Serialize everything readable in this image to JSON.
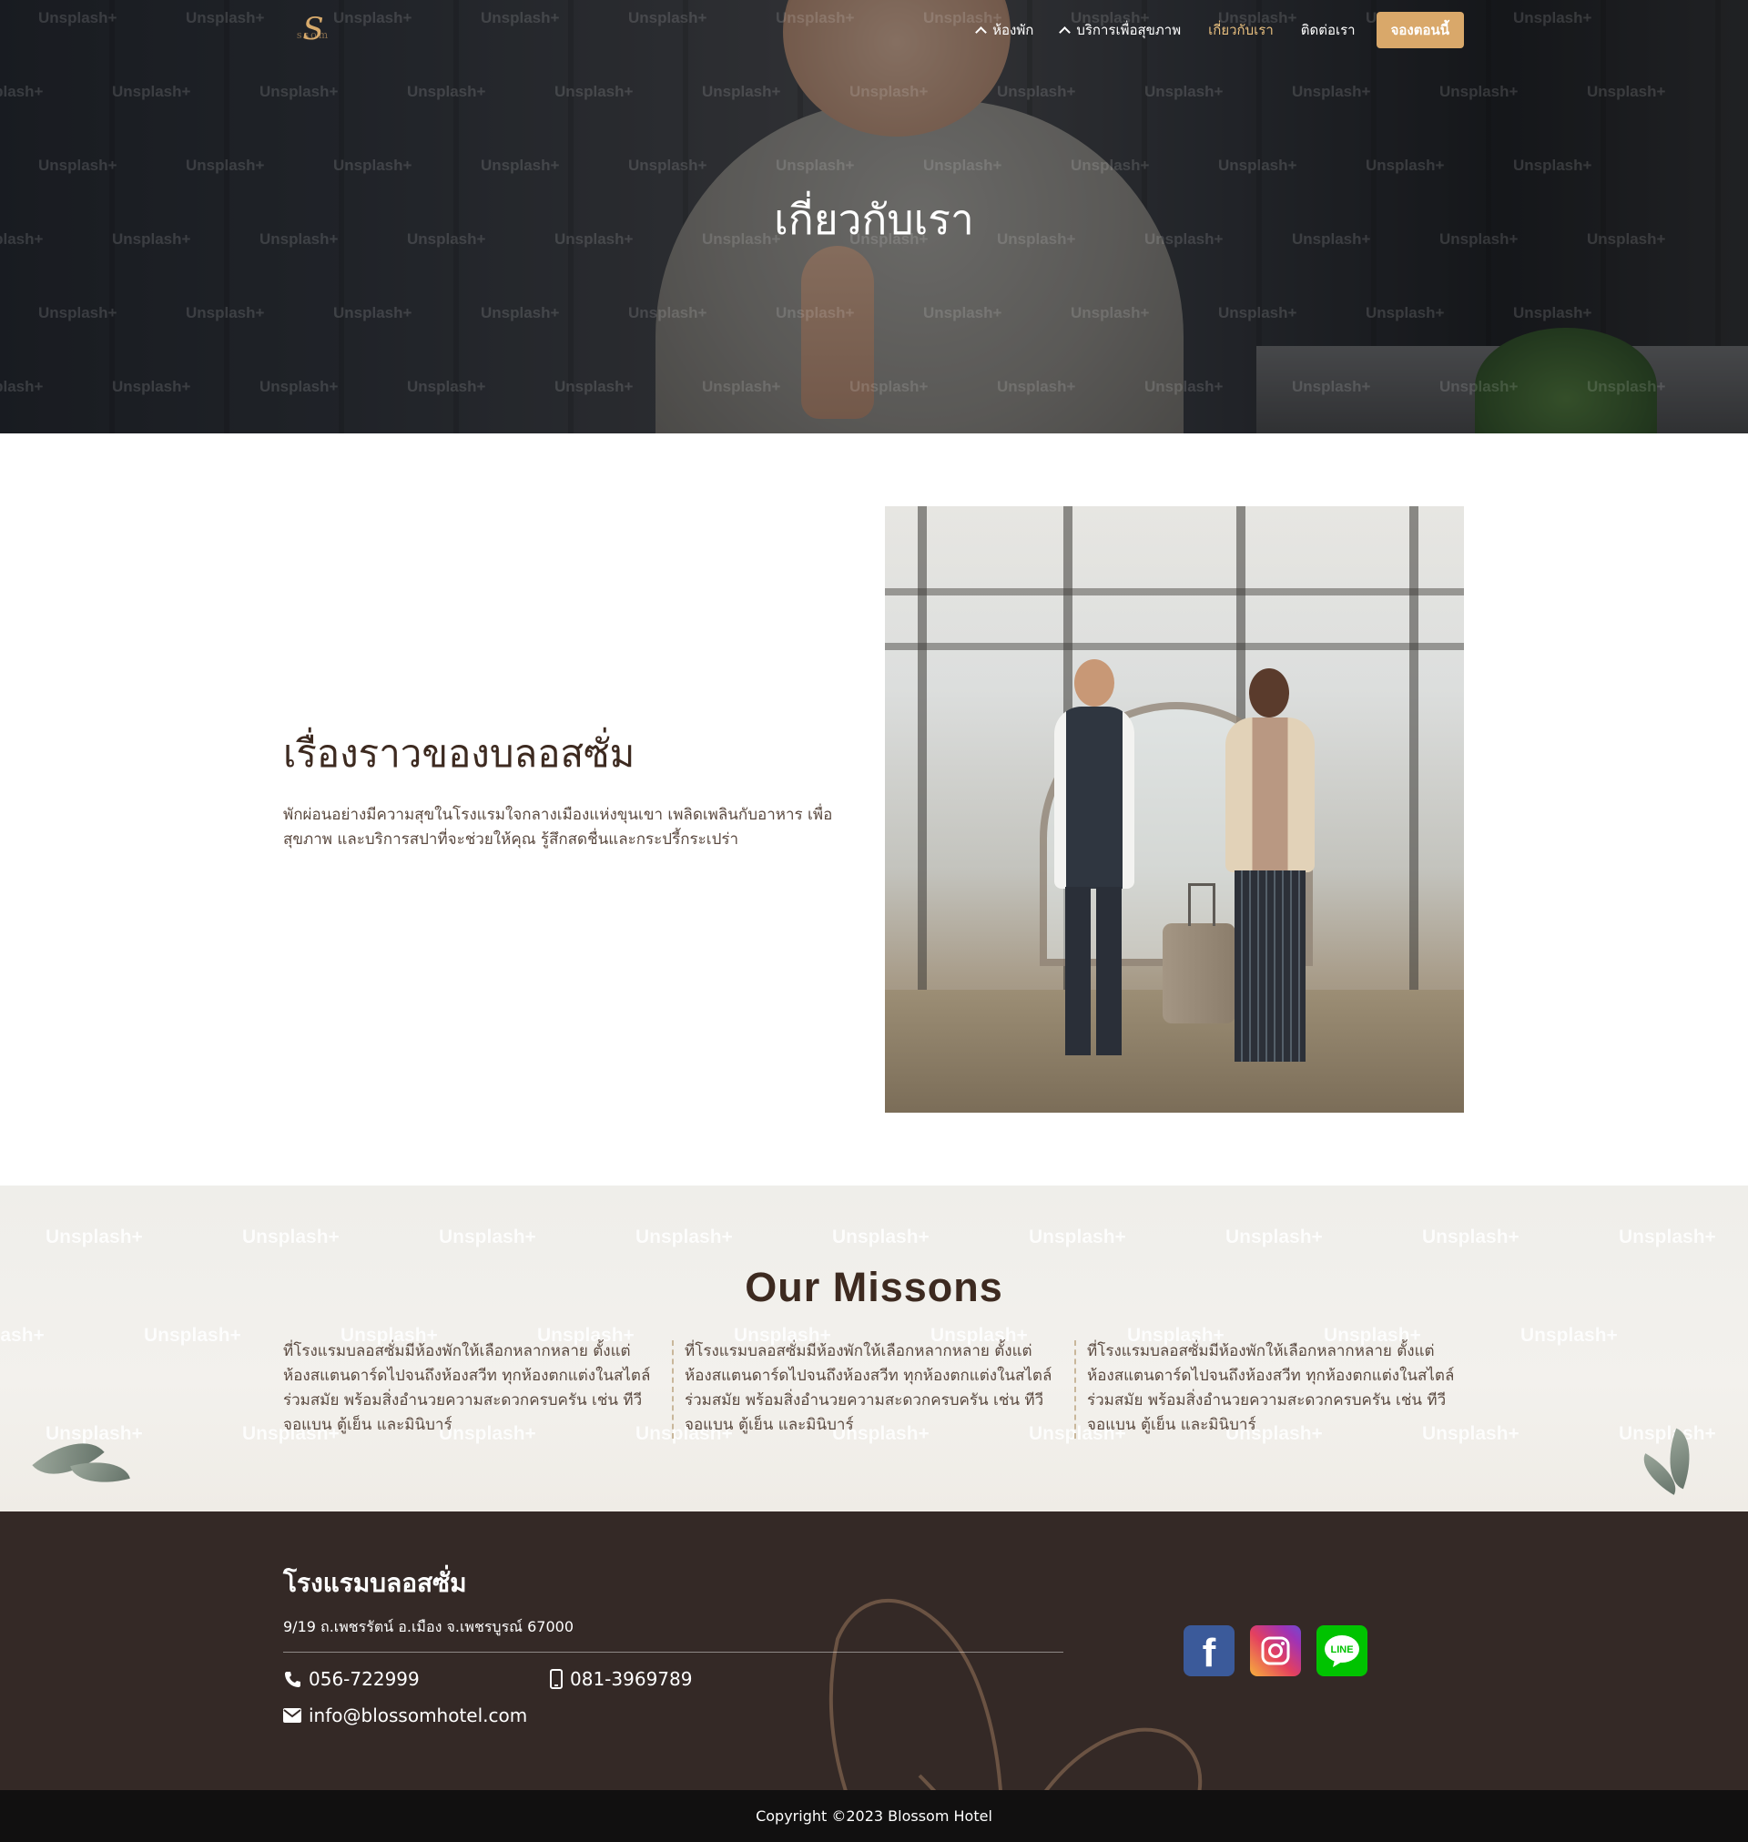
{
  "brand": {
    "logo_letter": "S",
    "logo_text": "ssom",
    "accent_color": "#d9a86a"
  },
  "nav": {
    "items": [
      {
        "label": "ห้องพัก",
        "has_caret": true
      },
      {
        "label": "บริการเพื่อสุขภาพ",
        "has_caret": true
      },
      {
        "label": "เกี่ยวกับเรา",
        "active": true
      },
      {
        "label": "ติดต่อเรา"
      }
    ],
    "book_label": "จองตอนนี้"
  },
  "hero": {
    "title": "เกี่ยวกับเรา",
    "watermark": "Unsplash+"
  },
  "story": {
    "heading": "เรื่องราวของบลอสซั่ม",
    "text": "พักผ่อนอย่างมีความสุขในโรงแรมใจกลางเมืองแห่งขุนเขา เพลิดเพลินกับอาหาร เพื่อสุขภาพ และบริการสปาที่จะช่วยให้คุณ รู้สึกสดชื่นและกระปรี้กระเปร่า"
  },
  "missions": {
    "title": "Our Missons",
    "watermark": "Unsplash+",
    "columns": [
      "ที่โรงแรมบลอสซั่มมีห้องพักให้เลือกหลากหลาย ตั้งแต่ห้องสแตนดาร์ดไปจนถึงห้องสวีท ทุกห้องตกแต่งในสไตล์ร่วมสมัย พร้อมสิ่งอำนวยความสะดวกครบครัน เช่น ทีวีจอแบน ตู้เย็น และมินิบาร์",
      "ที่โรงแรมบลอสซั่มมีห้องพักให้เลือกหลากหลาย ตั้งแต่ห้องสแตนดาร์ดไปจนถึงห้องสวีท ทุกห้องตกแต่งในสไตล์ร่วมสมัย พร้อมสิ่งอำนวยความสะดวกครบครัน เช่น ทีวีจอแบน ตู้เย็น และมินิบาร์",
      "ที่โรงแรมบลอสซั่มมีห้องพักให้เลือกหลากหลาย ตั้งแต่ห้องสแตนดาร์ดไปจนถึงห้องสวีท ทุกห้องตกแต่งในสไตล์ร่วมสมัย พร้อมสิ่งอำนวยความสะดวกครบครัน เช่น ทีวีจอแบน ตู้เย็น และมินิบาร์"
    ]
  },
  "footer": {
    "name": "โรงแรมบลอสซั่ม",
    "address": "9/19 ถ.เพชรรัตน์ อ.เมือง จ.เพชรบูรณ์ 67000",
    "phone": "056-722999",
    "mobile": "081-3969789",
    "email": "info@blossomhotel.com",
    "social": {
      "facebook": "f",
      "line": "LINE"
    },
    "copyright": "Copyright ©2023 Blossom Hotel"
  }
}
